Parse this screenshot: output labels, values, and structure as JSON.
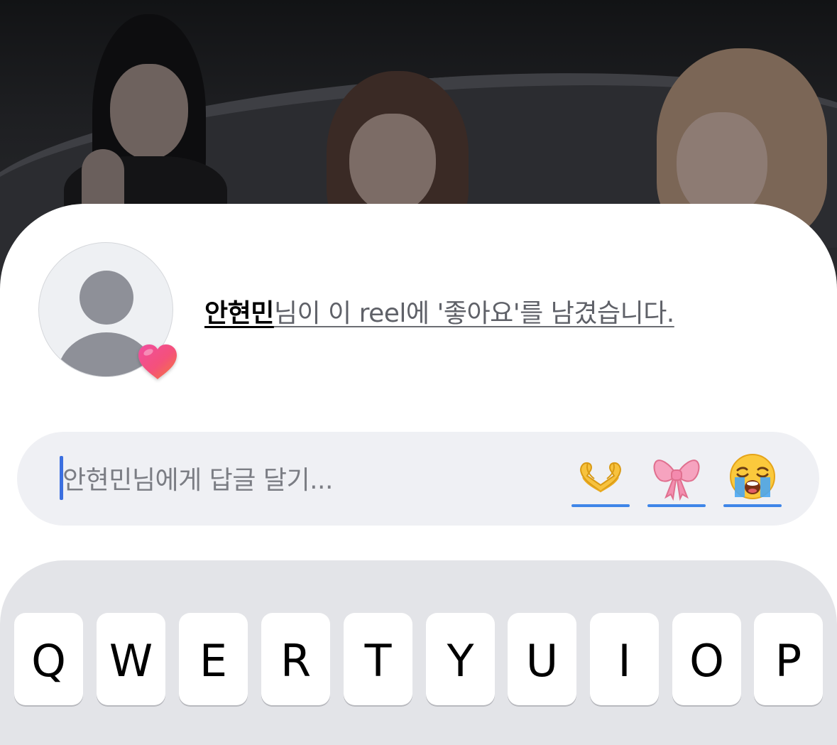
{
  "notification": {
    "username": "안현민",
    "message": "님이 이 reel에 '좋아요'를 남겼습니다."
  },
  "reply": {
    "placeholder": "안현민님에게 답글 달기..."
  },
  "quick_reactions": [
    {
      "icon": "heart-hands-emoji",
      "label": "🫶"
    },
    {
      "icon": "pink-ribbon-emoji",
      "label": "🎀"
    },
    {
      "icon": "loudly-crying-face-emoji",
      "label": "😭"
    }
  ],
  "keyboard": {
    "top_row": [
      "Q",
      "W",
      "E",
      "R",
      "T",
      "Y",
      "U",
      "I",
      "O",
      "P"
    ]
  },
  "colors": {
    "accent_blue": "#3f86e8",
    "caret": "#3b6fe0",
    "field_bg": "#eff0f4",
    "keyboard_bg": "#e3e4e8"
  }
}
